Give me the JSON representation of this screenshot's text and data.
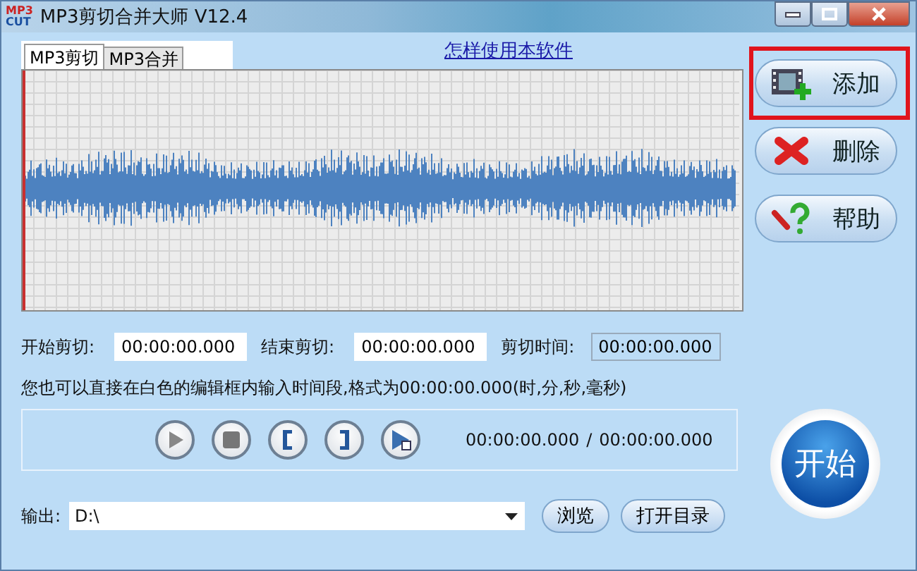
{
  "window": {
    "title": "MP3剪切合并大师 V12.4",
    "app_icon": {
      "top": "MP3",
      "bottom": "CUT"
    }
  },
  "tabs": [
    {
      "label": "MP3剪切",
      "selected": true
    },
    {
      "label": "MP3合并",
      "selected": false
    }
  ],
  "help_link": "怎样使用本软件",
  "side_buttons": [
    {
      "label": "添加",
      "kind": "add",
      "highlighted": true
    },
    {
      "label": "删除",
      "kind": "delete",
      "highlighted": false
    },
    {
      "label": "帮助",
      "kind": "help",
      "highlighted": false
    }
  ],
  "cut_fields": [
    {
      "label": "开始剪切:",
      "value": "00:00:00.000",
      "editable": true
    },
    {
      "label": "结束剪切:",
      "value": "00:00:00.000",
      "editable": true
    },
    {
      "label": "剪切时间:",
      "value": "00:00:00.000",
      "editable": false
    }
  ],
  "hint": "您也可以直接在白色的编辑框内输入时间段,格式为00:00:00.000(时,分,秒,毫秒)",
  "player": {
    "controls": [
      {
        "kind": "play"
      },
      {
        "kind": "stop"
      },
      {
        "kind": "mark-start"
      },
      {
        "kind": "mark-end"
      },
      {
        "kind": "play-selection"
      }
    ],
    "position": "00:00:00.000",
    "separator": "/",
    "duration": "00:00:00.000"
  },
  "output": {
    "label": "输出:",
    "value": "D:\\",
    "buttons": [
      "浏览",
      "打开目录"
    ]
  },
  "start_button": "开始"
}
